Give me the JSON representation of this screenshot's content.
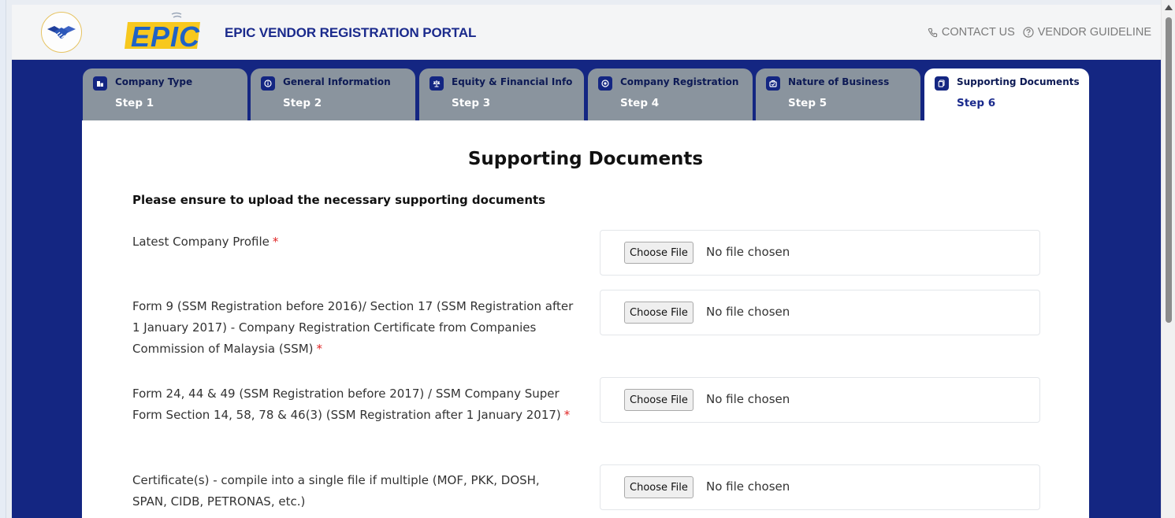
{
  "header": {
    "logo_text": "EPIC",
    "portal_title": "EPIC VENDOR REGISTRATION PORTAL",
    "contact_label": "CONTACT US",
    "guideline_label": "VENDOR GUIDELINE"
  },
  "tabs": [
    {
      "name": "Company Type",
      "step": "Step 1",
      "icon": "building-icon",
      "active": false
    },
    {
      "name": "General Information",
      "step": "Step 2",
      "icon": "info-icon",
      "active": false
    },
    {
      "name": "Equity & Financial Info",
      "step": "Step 3",
      "icon": "scale-icon",
      "active": false
    },
    {
      "name": "Company Registration",
      "step": "Step 4",
      "icon": "registration-icon",
      "active": false
    },
    {
      "name": "Nature of Business",
      "step": "Step 5",
      "icon": "briefcase-icon",
      "active": false
    },
    {
      "name": "Supporting Documents",
      "step": "Step 6",
      "icon": "document-icon",
      "active": true
    }
  ],
  "main": {
    "title": "Supporting Documents",
    "subtitle": "Please ensure to upload the necessary supporting documents",
    "required_mark": "*",
    "choose_file_label": "Choose File",
    "no_file_text": "No file chosen",
    "documents": [
      {
        "label": "Latest Company Profile",
        "required": true
      },
      {
        "label": "Form 9 (SSM Registration before 2016)/ Section 17 (SSM Registration after 1 January 2017) - Company Registration Certificate from Companies Commission of Malaysia (SSM)",
        "required": true
      },
      {
        "label": "Form 24, 44 & 49 (SSM Registration before 2017) / SSM Company Super Form Section 14, 58, 78 & 46(3) (SSM Registration after 1 January 2017)",
        "required": true
      },
      {
        "label": "Certificate(s) - compile into a single file if multiple (MOF, PKK, DOSH, SPAN, CIDB, PETRONAS, etc.)",
        "required": false
      }
    ]
  },
  "colors": {
    "brand_navy": "#142682",
    "title_blue": "#1a2a8c",
    "tab_inactive": "#8a949e",
    "logo_yellow": "#f7c81e",
    "logo_blue": "#1f62c6",
    "required_red": "#e02424"
  }
}
